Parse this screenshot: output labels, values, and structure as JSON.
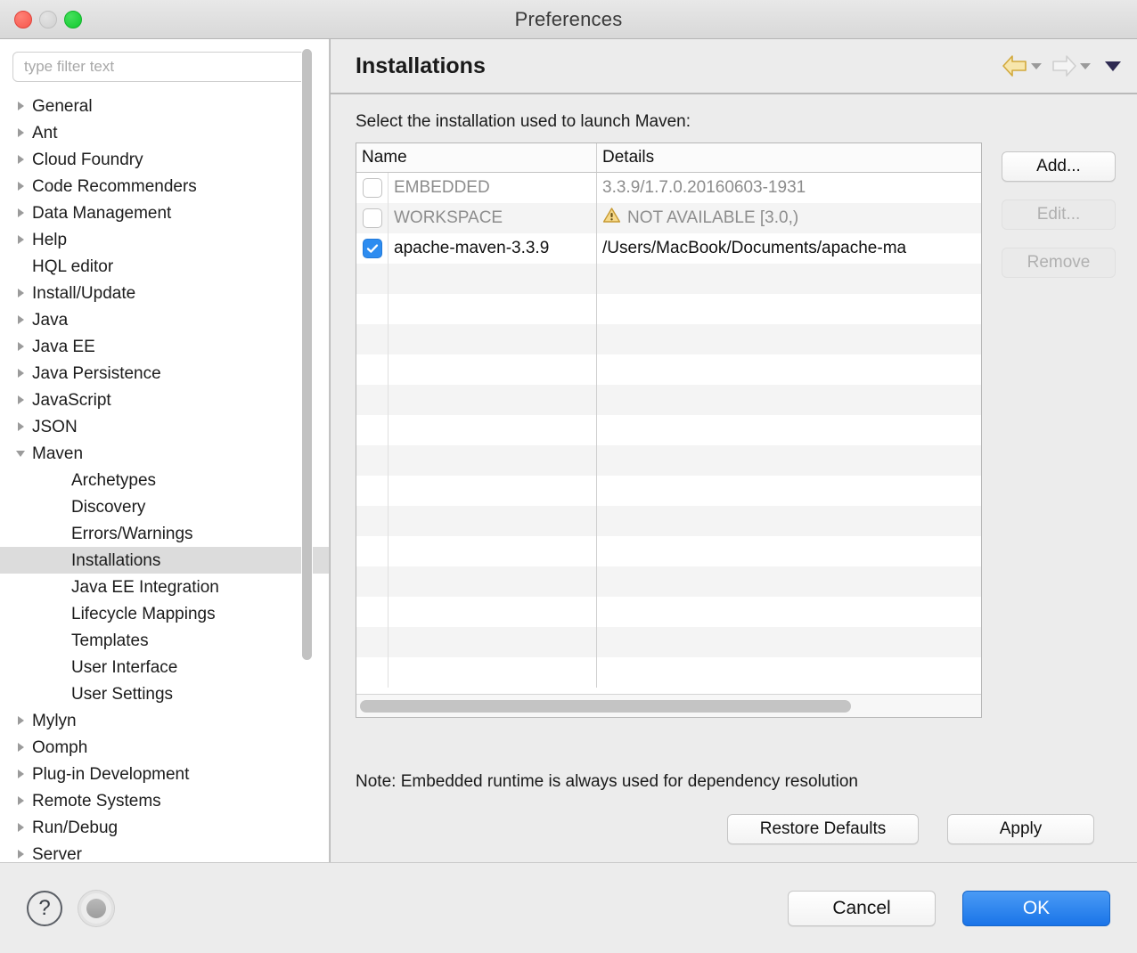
{
  "window": {
    "title": "Preferences",
    "traffic": {
      "close": "close-button",
      "minimize": "minimize-button",
      "zoom": "zoom-button"
    }
  },
  "sidebar": {
    "filter": {
      "placeholder": "type filter text",
      "value": ""
    },
    "items": [
      {
        "label": "General",
        "level": 1,
        "expandable": true,
        "expanded": false,
        "selected": false
      },
      {
        "label": "Ant",
        "level": 1,
        "expandable": true,
        "expanded": false,
        "selected": false
      },
      {
        "label": "Cloud Foundry",
        "level": 1,
        "expandable": true,
        "expanded": false,
        "selected": false
      },
      {
        "label": "Code Recommenders",
        "level": 1,
        "expandable": true,
        "expanded": false,
        "selected": false
      },
      {
        "label": "Data Management",
        "level": 1,
        "expandable": true,
        "expanded": false,
        "selected": false
      },
      {
        "label": "Help",
        "level": 1,
        "expandable": true,
        "expanded": false,
        "selected": false
      },
      {
        "label": "HQL editor",
        "level": 1,
        "expandable": false,
        "expanded": false,
        "selected": false
      },
      {
        "label": "Install/Update",
        "level": 1,
        "expandable": true,
        "expanded": false,
        "selected": false
      },
      {
        "label": "Java",
        "level": 1,
        "expandable": true,
        "expanded": false,
        "selected": false
      },
      {
        "label": "Java EE",
        "level": 1,
        "expandable": true,
        "expanded": false,
        "selected": false
      },
      {
        "label": "Java Persistence",
        "level": 1,
        "expandable": true,
        "expanded": false,
        "selected": false
      },
      {
        "label": "JavaScript",
        "level": 1,
        "expandable": true,
        "expanded": false,
        "selected": false
      },
      {
        "label": "JSON",
        "level": 1,
        "expandable": true,
        "expanded": false,
        "selected": false
      },
      {
        "label": "Maven",
        "level": 1,
        "expandable": true,
        "expanded": true,
        "selected": false
      },
      {
        "label": "Archetypes",
        "level": 2,
        "expandable": false,
        "expanded": false,
        "selected": false
      },
      {
        "label": "Discovery",
        "level": 2,
        "expandable": false,
        "expanded": false,
        "selected": false
      },
      {
        "label": "Errors/Warnings",
        "level": 2,
        "expandable": false,
        "expanded": false,
        "selected": false
      },
      {
        "label": "Installations",
        "level": 2,
        "expandable": false,
        "expanded": false,
        "selected": true
      },
      {
        "label": "Java EE Integration",
        "level": 2,
        "expandable": false,
        "expanded": false,
        "selected": false
      },
      {
        "label": "Lifecycle Mappings",
        "level": 2,
        "expandable": false,
        "expanded": false,
        "selected": false
      },
      {
        "label": "Templates",
        "level": 2,
        "expandable": false,
        "expanded": false,
        "selected": false
      },
      {
        "label": "User Interface",
        "level": 2,
        "expandable": false,
        "expanded": false,
        "selected": false
      },
      {
        "label": "User Settings",
        "level": 2,
        "expandable": false,
        "expanded": false,
        "selected": false
      },
      {
        "label": "Mylyn",
        "level": 1,
        "expandable": true,
        "expanded": false,
        "selected": false
      },
      {
        "label": "Oomph",
        "level": 1,
        "expandable": true,
        "expanded": false,
        "selected": false
      },
      {
        "label": "Plug-in Development",
        "level": 1,
        "expandable": true,
        "expanded": false,
        "selected": false
      },
      {
        "label": "Remote Systems",
        "level": 1,
        "expandable": true,
        "expanded": false,
        "selected": false
      },
      {
        "label": "Run/Debug",
        "level": 1,
        "expandable": true,
        "expanded": false,
        "selected": false
      },
      {
        "label": "Server",
        "level": 1,
        "expandable": true,
        "expanded": false,
        "selected": false
      }
    ]
  },
  "main": {
    "page_title": "Installations",
    "nav": {
      "back_icon": "back-arrow-icon",
      "forward_icon": "forward-arrow-icon",
      "menu_icon": "chevron-down-icon"
    },
    "instruction": "Select the installation used to launch Maven:",
    "table": {
      "columns": [
        "Name",
        "Details"
      ],
      "rows": [
        {
          "checked": false,
          "name": "EMBEDDED",
          "details": "3.3.9/1.7.0.20160603-1931",
          "warning": false,
          "enabled": false
        },
        {
          "checked": false,
          "name": "WORKSPACE",
          "details": "NOT AVAILABLE [3.0,)",
          "warning": true,
          "enabled": false
        },
        {
          "checked": true,
          "name": "apache-maven-3.3.9",
          "details": "/Users/MacBook/Documents/apache-ma",
          "warning": false,
          "enabled": true
        }
      ],
      "empty_row_count": 14
    },
    "side_buttons": [
      {
        "label": "Add...",
        "enabled": true
      },
      {
        "label": "Edit...",
        "enabled": false
      },
      {
        "label": "Remove",
        "enabled": false
      }
    ],
    "note": "Note: Embedded runtime is always used for dependency resolution",
    "restore_defaults_label": "Restore Defaults",
    "apply_label": "Apply"
  },
  "footer": {
    "help_icon": "help-question-icon",
    "record_icon": "record-circle-icon",
    "cancel_label": "Cancel",
    "ok_label": "OK"
  },
  "colors": {
    "accent_blue": "#2d8cf0",
    "ok_blue": "#1a74e8",
    "warning_yellow": "#f0c050",
    "back_arrow_gold": "#e8c264",
    "selection_gray": "#dcdcdc"
  }
}
